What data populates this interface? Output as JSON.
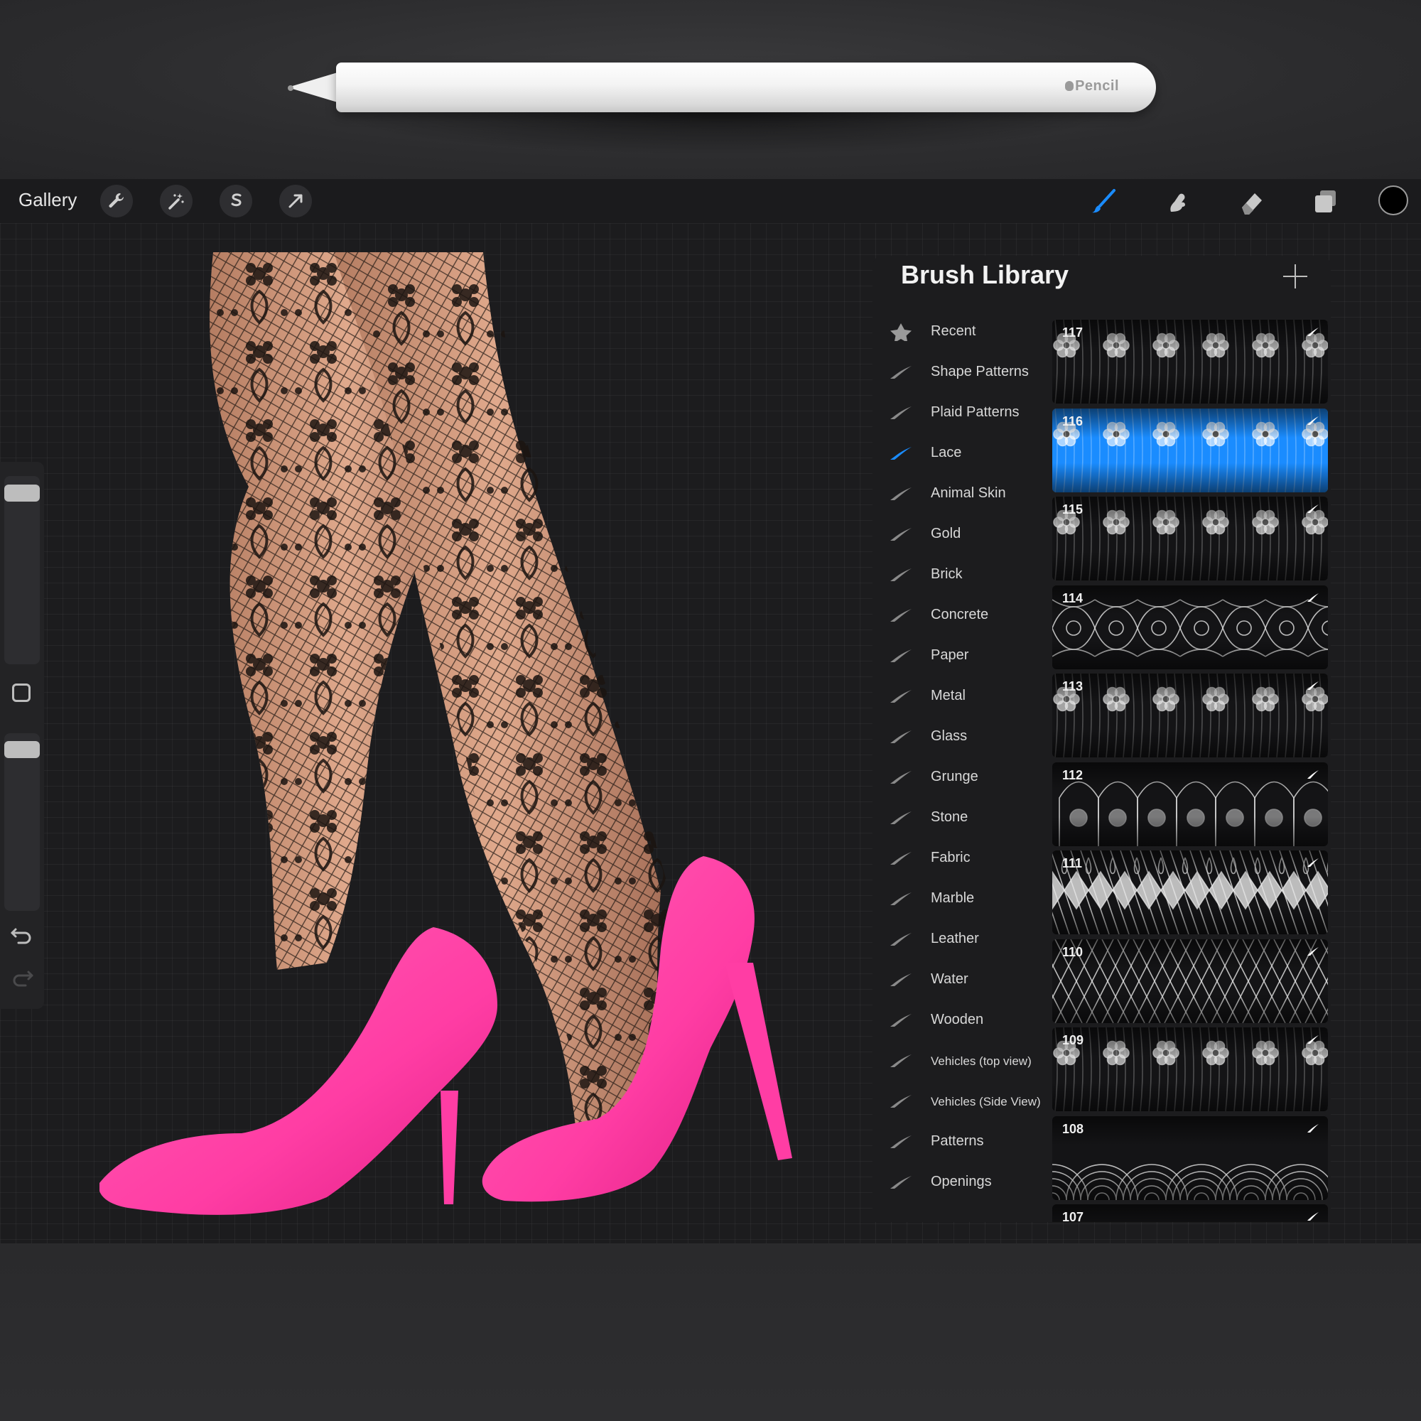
{
  "pencil": {
    "brand": "Pencil"
  },
  "toolbar": {
    "gallery_label": "Gallery",
    "left_tools": [
      {
        "name": "actions",
        "icon": "wrench-icon"
      },
      {
        "name": "adjustments",
        "icon": "magic-wand-icon"
      },
      {
        "name": "selection",
        "icon": "selection-s-icon"
      },
      {
        "name": "transform",
        "icon": "arrow-cursor-icon"
      }
    ],
    "right_tools": [
      {
        "name": "brush",
        "icon": "brush-icon",
        "active": true,
        "color": "#1a8cff"
      },
      {
        "name": "smudge",
        "icon": "smudge-icon"
      },
      {
        "name": "eraser",
        "icon": "eraser-icon"
      },
      {
        "name": "layers",
        "icon": "layers-icon"
      }
    ],
    "current_color": "#000000"
  },
  "sidebar": {
    "brush_size": 0.95,
    "opacity": 0.95
  },
  "brush_library": {
    "title": "Brush Library",
    "categories": [
      {
        "label": "Recent",
        "icon": "star-icon"
      },
      {
        "label": "Shape Patterns",
        "icon": "brush-stroke-icon"
      },
      {
        "label": "Plaid Patterns",
        "icon": "brush-stroke-icon"
      },
      {
        "label": "Lace",
        "icon": "brush-stroke-icon",
        "selected": true
      },
      {
        "label": "Animal Skin",
        "icon": "brush-stroke-icon"
      },
      {
        "label": "Gold",
        "icon": "brush-stroke-icon"
      },
      {
        "label": "Brick",
        "icon": "brush-stroke-icon"
      },
      {
        "label": "Concrete",
        "icon": "brush-stroke-icon"
      },
      {
        "label": "Paper",
        "icon": "brush-stroke-icon"
      },
      {
        "label": "Metal",
        "icon": "brush-stroke-icon"
      },
      {
        "label": "Glass",
        "icon": "brush-stroke-icon"
      },
      {
        "label": "Grunge",
        "icon": "brush-stroke-icon"
      },
      {
        "label": "Stone",
        "icon": "brush-stroke-icon"
      },
      {
        "label": "Fabric",
        "icon": "brush-stroke-icon"
      },
      {
        "label": "Marble",
        "icon": "brush-stroke-icon"
      },
      {
        "label": "Leather",
        "icon": "brush-stroke-icon"
      },
      {
        "label": "Water",
        "icon": "brush-stroke-icon"
      },
      {
        "label": "Wooden",
        "icon": "brush-stroke-icon"
      },
      {
        "label": "Vehicles (top view)",
        "icon": "brush-stroke-icon"
      },
      {
        "label": "Vehicles (Side View)",
        "icon": "brush-stroke-icon"
      },
      {
        "label": "Patterns",
        "icon": "brush-stroke-icon"
      },
      {
        "label": "Openings",
        "icon": "brush-stroke-icon"
      }
    ],
    "brushes": [
      {
        "number": "117",
        "pattern": "floral-lace"
      },
      {
        "number": "116",
        "pattern": "floral-lace",
        "selected": true
      },
      {
        "number": "115",
        "pattern": "floral-lace"
      },
      {
        "number": "114",
        "pattern": "baroque-lace"
      },
      {
        "number": "113",
        "pattern": "floral-lace"
      },
      {
        "number": "112",
        "pattern": "arch-lace"
      },
      {
        "number": "111",
        "pattern": "diamond-lace"
      },
      {
        "number": "110",
        "pattern": "fishnet"
      },
      {
        "number": "109",
        "pattern": "floral-lace"
      },
      {
        "number": "108",
        "pattern": "scallop-lace"
      },
      {
        "number": "107",
        "pattern": "scallop-lace"
      }
    ],
    "accent_color": "#1a8cff"
  }
}
